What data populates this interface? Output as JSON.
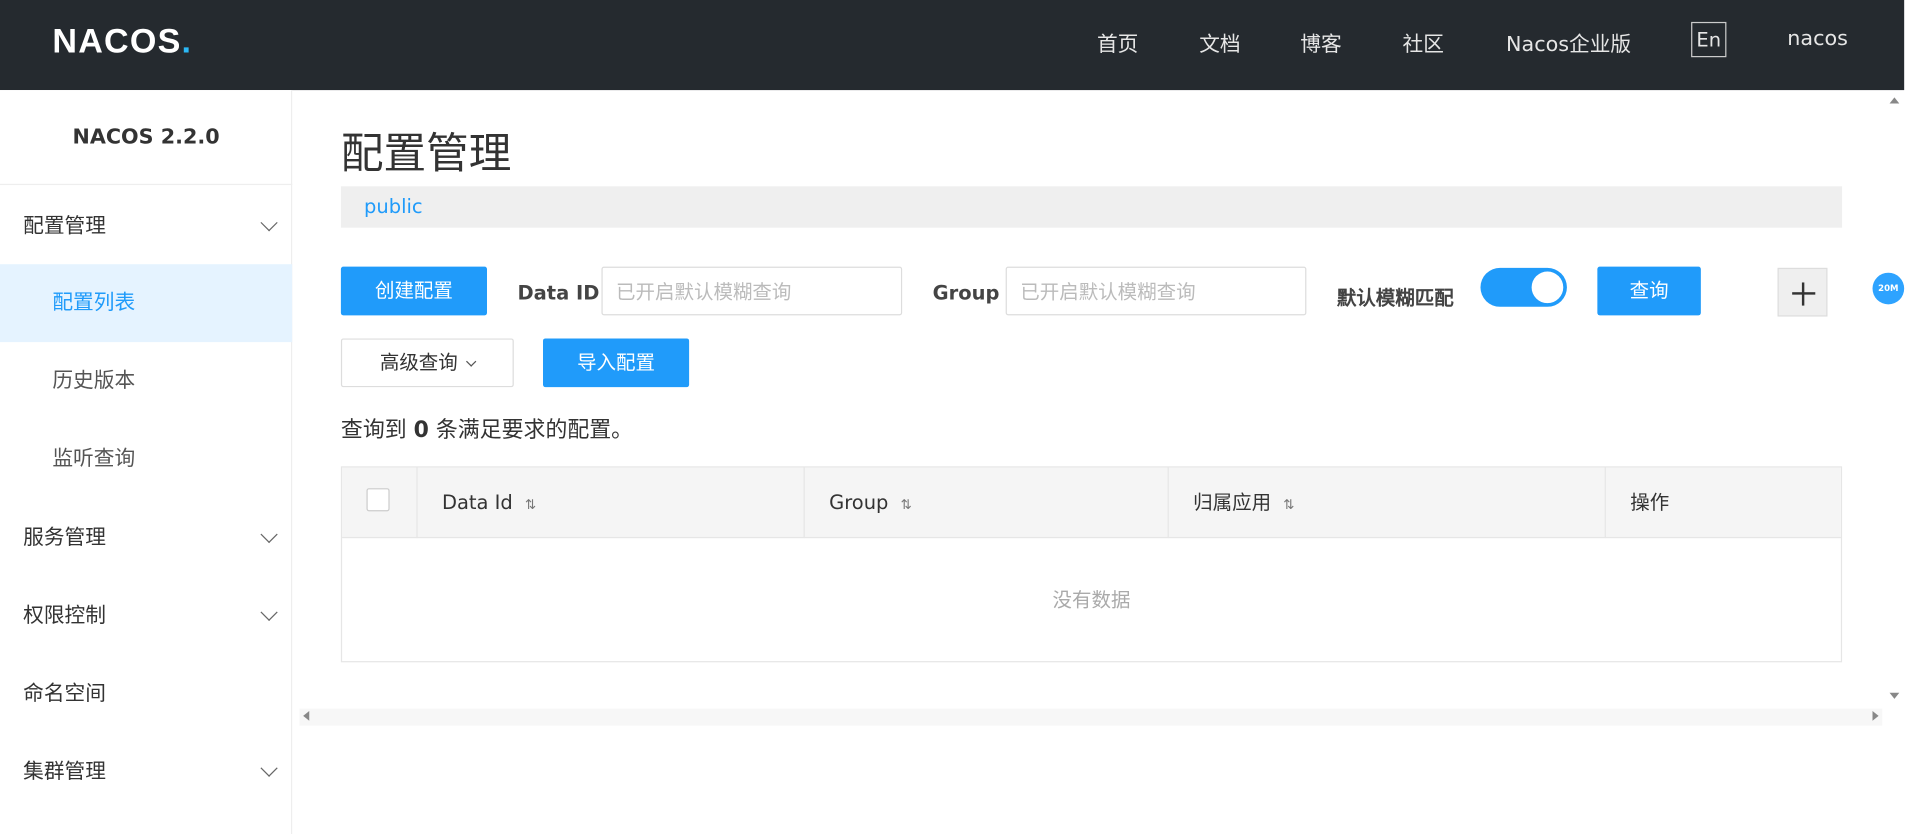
{
  "header": {
    "logo": "NACOS",
    "logo_dot": ".",
    "nav": [
      "首页",
      "文档",
      "博客",
      "社区",
      "Nacos企业版"
    ],
    "lang": "En",
    "user": "nacos"
  },
  "sidebar": {
    "version": "NACOS 2.2.0",
    "items": [
      {
        "label": "配置管理"
      },
      {
        "label": "配置列表"
      },
      {
        "label": "历史版本"
      },
      {
        "label": "监听查询"
      },
      {
        "label": "服务管理"
      },
      {
        "label": "权限控制"
      },
      {
        "label": "命名空间"
      },
      {
        "label": "集群管理"
      }
    ]
  },
  "main": {
    "title": "配置管理",
    "namespace": "public",
    "create_btn": "创建配置",
    "data_id_label": "Data ID",
    "data_id_placeholder": "已开启默认模糊查询",
    "group_label": "Group",
    "group_placeholder": "已开启默认模糊查询",
    "fuzzy_label": "默认模糊匹配",
    "search_btn": "查询",
    "advanced_btn": "高级查询",
    "import_btn": "导入配置",
    "summary_prefix": "查询到",
    "summary_count": "0",
    "summary_suffix": "条满足要求的配置。",
    "columns": [
      "Data Id",
      "Group",
      "归属应用",
      "操作"
    ],
    "empty_text": "没有数据"
  },
  "float_badge": "20M",
  "colors": {
    "accent": "#209bfa",
    "header_bg": "#252a2f"
  }
}
